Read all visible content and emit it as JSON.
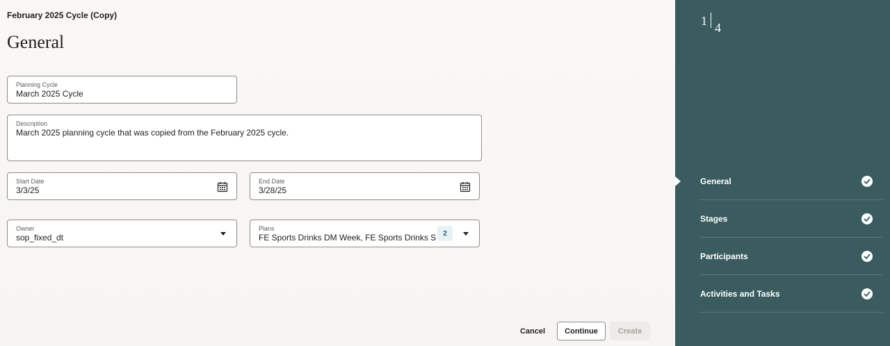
{
  "header": {
    "cycle_name": "February 2025 Cycle (Copy)",
    "page_title": "General"
  },
  "form": {
    "planning_cycle": {
      "label": "Planning Cycle",
      "value": "March 2025 Cycle"
    },
    "description": {
      "label": "Description",
      "value": "March 2025 planning cycle that was copied from the February 2025 cycle."
    },
    "start_date": {
      "label": "Start Date",
      "value": "3/3/25"
    },
    "end_date": {
      "label": "End Date",
      "value": "3/28/25"
    },
    "owner": {
      "label": "Owner",
      "value": "sop_fixed_dt"
    },
    "plans": {
      "label": "Plans",
      "value": "FE Sports Drinks DM Week, FE Sports Drinks S",
      "count": "2"
    }
  },
  "footer": {
    "cancel": "Cancel",
    "continue": "Continue",
    "create": "Create"
  },
  "sidebar": {
    "current_step": "1",
    "total_steps": "4",
    "steps": [
      {
        "label": "General",
        "status": "complete",
        "current": true
      },
      {
        "label": "Stages",
        "status": "complete"
      },
      {
        "label": "Participants",
        "status": "complete"
      },
      {
        "label": "Activities and Tasks",
        "status": "complete"
      }
    ],
    "colors": {
      "background": "#3a5c5f",
      "divider": "#55797c"
    }
  }
}
